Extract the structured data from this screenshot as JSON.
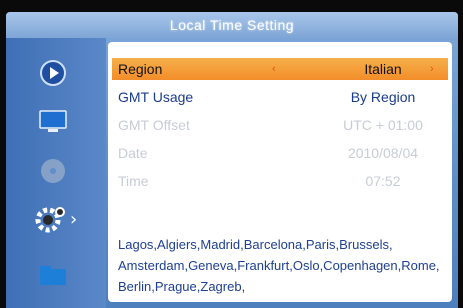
{
  "title": "Local Time Setting",
  "rows": [
    {
      "label": "Region",
      "value": "Italian"
    },
    {
      "label": "GMT Usage",
      "value": "By Region"
    },
    {
      "label": "GMT Offset",
      "value": "UTC + 01:00"
    },
    {
      "label": "Date",
      "value": "2010/08/04"
    },
    {
      "label": "Time",
      "value": "07:52"
    }
  ],
  "cities_text": "Lagos,Algiers,Madrid,Barcelona,Paris,Brussels,Amsterdam,Geneva,Frankfurt,Oslo,Copenhagen,Rome,Berlin,Prague,Zagreb,",
  "arrows": {
    "left": "‹",
    "right": "›"
  },
  "sidebar": {
    "icons": [
      "play-icon",
      "monitor-icon",
      "disc-icon",
      "gear-icon",
      "folder-icon"
    ],
    "expand_glyph": "›"
  },
  "colors": {
    "highlight": "#f28d2a",
    "active_text": "#1a3c8c",
    "dim_text": "#c7ccd6",
    "city_text": "#1e3f93"
  }
}
